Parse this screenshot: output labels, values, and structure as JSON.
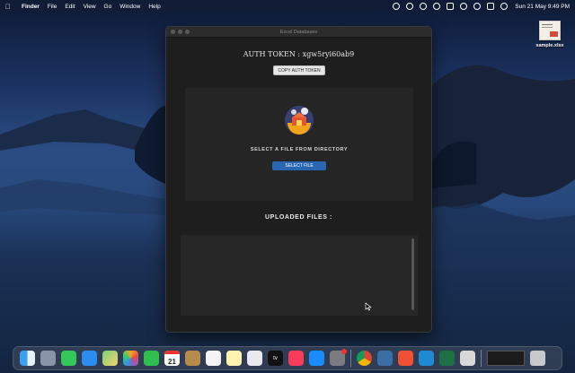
{
  "menubar": {
    "items": [
      "Finder",
      "File",
      "Edit",
      "View",
      "Go",
      "Window",
      "Help"
    ],
    "clock": "Sun 21 May  9:49 PM"
  },
  "desktop": {
    "file_name": "sample.xlsx"
  },
  "window": {
    "title": "Excel Databases",
    "auth_token": "AUTH TOKEN : xgw5ryi60ab9",
    "copy_button": "COPY AUTH TOKEN",
    "select_prompt": "SELECT A FILE FROM DIRECTORY",
    "select_button": "SELECT FILE",
    "uploaded_title": "UPLOADED FILES :"
  },
  "dock": {
    "apps": [
      "finder-icon",
      "launchpad-icon",
      "messages-icon",
      "mail-icon",
      "maps-icon",
      "photos-icon",
      "facetime-icon",
      "calendar-icon",
      "notes-icon",
      "reminders-icon",
      "freeform-icon",
      "safari-icon",
      "tv-icon",
      "music-icon",
      "app-store-icon",
      "system-settings-icon",
      "chrome-icon",
      "sequel-icon",
      "git-icon",
      "vscode-icon",
      "excel-icon",
      "preview-icon"
    ],
    "calendar_day": "21",
    "calendar_month": "MAY",
    "tv_label": "tv"
  },
  "colors": {
    "accent": "#2966b1",
    "window_bg": "#1e1e1e"
  }
}
